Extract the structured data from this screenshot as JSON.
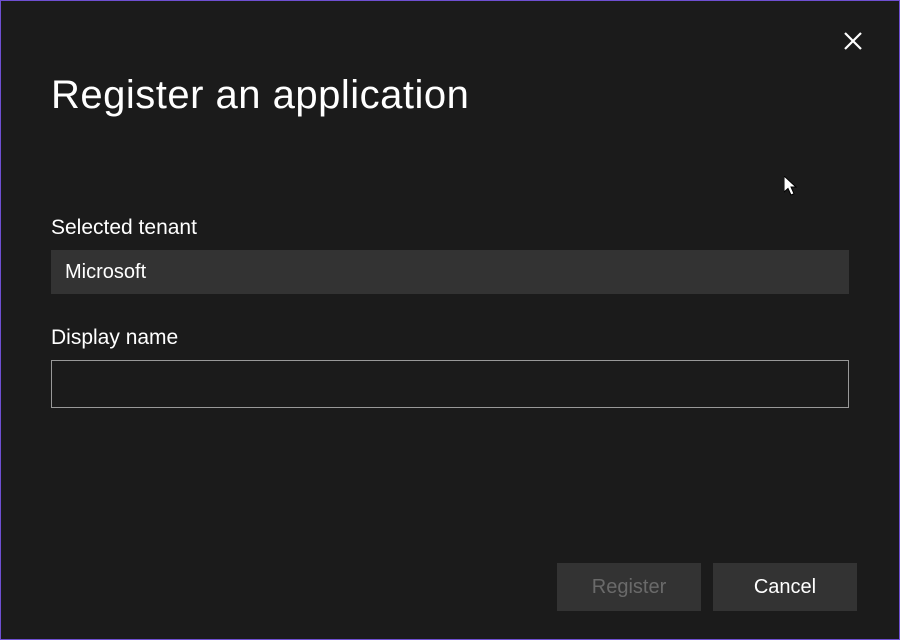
{
  "dialog": {
    "title": "Register an application",
    "fields": {
      "tenant": {
        "label": "Selected tenant",
        "value": "Microsoft"
      },
      "displayName": {
        "label": "Display name",
        "value": ""
      }
    },
    "buttons": {
      "register": "Register",
      "cancel": "Cancel"
    }
  }
}
